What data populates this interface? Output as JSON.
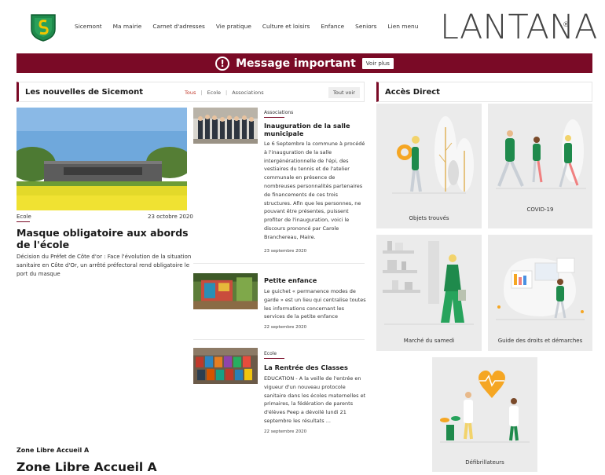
{
  "nav": {
    "items": [
      "Sicemont",
      "Ma mairie",
      "Carnet d'adresses",
      "Vie pratique",
      "Culture et loisirs",
      "Enfance",
      "Seniors",
      "Lien menu"
    ]
  },
  "brand": {
    "text": "LANTANA",
    "mark": "®"
  },
  "alert": {
    "title": "Message important",
    "button": "Voir plus",
    "icon": "!"
  },
  "news": {
    "title": "Les nouvelles de Sicemont",
    "filters": [
      "Tous",
      "Ecole",
      "Associations"
    ],
    "see_all": "Tout voir",
    "featured": {
      "category": "Ecole",
      "date": "23 octobre 2020",
      "title": "Masque obligatoire aux abords de l'école",
      "text": "Décision du Préfet de Côte d'or : Face l'évolution de la situation sanitaire en Côte d'Or, un arrêté préfectoral rend obligatoire le port du masque"
    },
    "articles": [
      {
        "category": "Associations",
        "title": "Inauguration de la salle municipale",
        "text": "Le 6 Septembre la commune à procédé à l'inauguration de la salle intergénérationnelle de l'épi, des vestiaires du tennis et de l'atelier communale en présence de nombreuses personnalités partenaires de financements de ces trois structures. Afin que les personnes, ne pouvant être présentes, puissent profiter de l'inauguration, voici le discours prononcé par Carole Branchereau, Maire.",
        "date": "23 septembre 2020"
      },
      {
        "category": "",
        "title": "Petite enfance",
        "text": "Le guichet « permanence modes de garde » est un lieu qui centralise toutes les informations concernant les services de la petite enfance",
        "date": "22 septembre 2020"
      },
      {
        "category": "Ecole",
        "title": "La Rentrée des Classes",
        "text": "EDUCATION - A la veille de l'entrée en vigueur d'un nouveau protocole sanitaire dans les écoles maternelles et primaires, la fédération de parents d'élèves Peep a dévoilé lundi 21 septembre les résultats ...",
        "date": "22 septembre 2020"
      }
    ]
  },
  "access": {
    "title": "Accès Direct",
    "tiles": [
      "Objets trouvés",
      "COVID-19",
      "Marché du samedi",
      "Guide des droits et démarches",
      "Défibrillateurs"
    ]
  },
  "zone": {
    "small": "Zone Libre Accueil A",
    "big": "Zone Libre Accueil A"
  },
  "colors": {
    "accent": "#7a0a26",
    "green": "#1f8a4c",
    "yellow": "#f2c500"
  }
}
